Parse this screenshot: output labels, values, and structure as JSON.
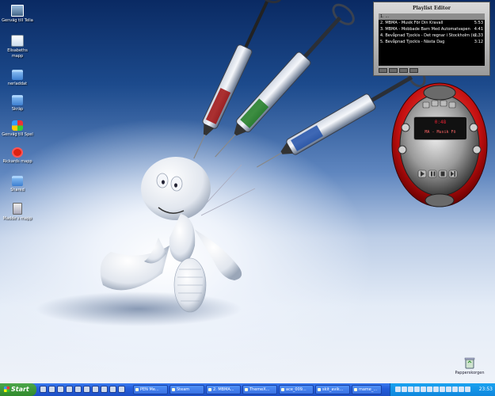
{
  "desktop": {
    "icons": [
      {
        "label": "Genväg till Telia",
        "icon": "computer-shortcut-icon"
      },
      {
        "label": "Elisabeths\nmapp",
        "icon": "home-folder-icon"
      },
      {
        "label": "nerladdat",
        "icon": "folder-icon"
      },
      {
        "label": "Skräp",
        "icon": "folder-icon"
      },
      {
        "label": "Genväg till Spel",
        "icon": "games-shortcut-icon"
      },
      {
        "label": "Rickards mapp",
        "icon": "no-entry-icon"
      },
      {
        "label": "Shared",
        "icon": "folder-icon"
      },
      {
        "label": "Madde's mapp",
        "icon": "user-folder-icon"
      }
    ],
    "recycle_bin": {
      "label": "Papperskorgen",
      "icon": "recycle-bin-icon"
    }
  },
  "playlist_editor": {
    "title": "Playlist Editor",
    "rows": [
      {
        "text": "1. ...",
        "time": ""
      },
      {
        "text": "2. MBMA - Musik För Din Kravall",
        "time": "5:53"
      },
      {
        "text": "3. MBMA - Mobbade Barn Med Automatvapen",
        "time": "4:41"
      },
      {
        "text": "4. Bevåpnad Tjockis - Det regnar i Stockholm (in...",
        "time": "2:33"
      },
      {
        "text": "5. Bevåpnad Tjockis - Nästa Dag",
        "time": "3:12"
      }
    ],
    "selected_index": 0,
    "total": ""
  },
  "player": {
    "time": "0:48",
    "track": "MA - Musik Fö",
    "accent": "#d41b1b"
  },
  "taskbar": {
    "start_label": "Start",
    "tasks": [
      "PEN Me...",
      "Steam",
      "2. MBMA...",
      "ThemeX...",
      "ace_009...",
      "skit_avik...",
      "mame_...",
      "..."
    ],
    "clock": "23:53"
  }
}
